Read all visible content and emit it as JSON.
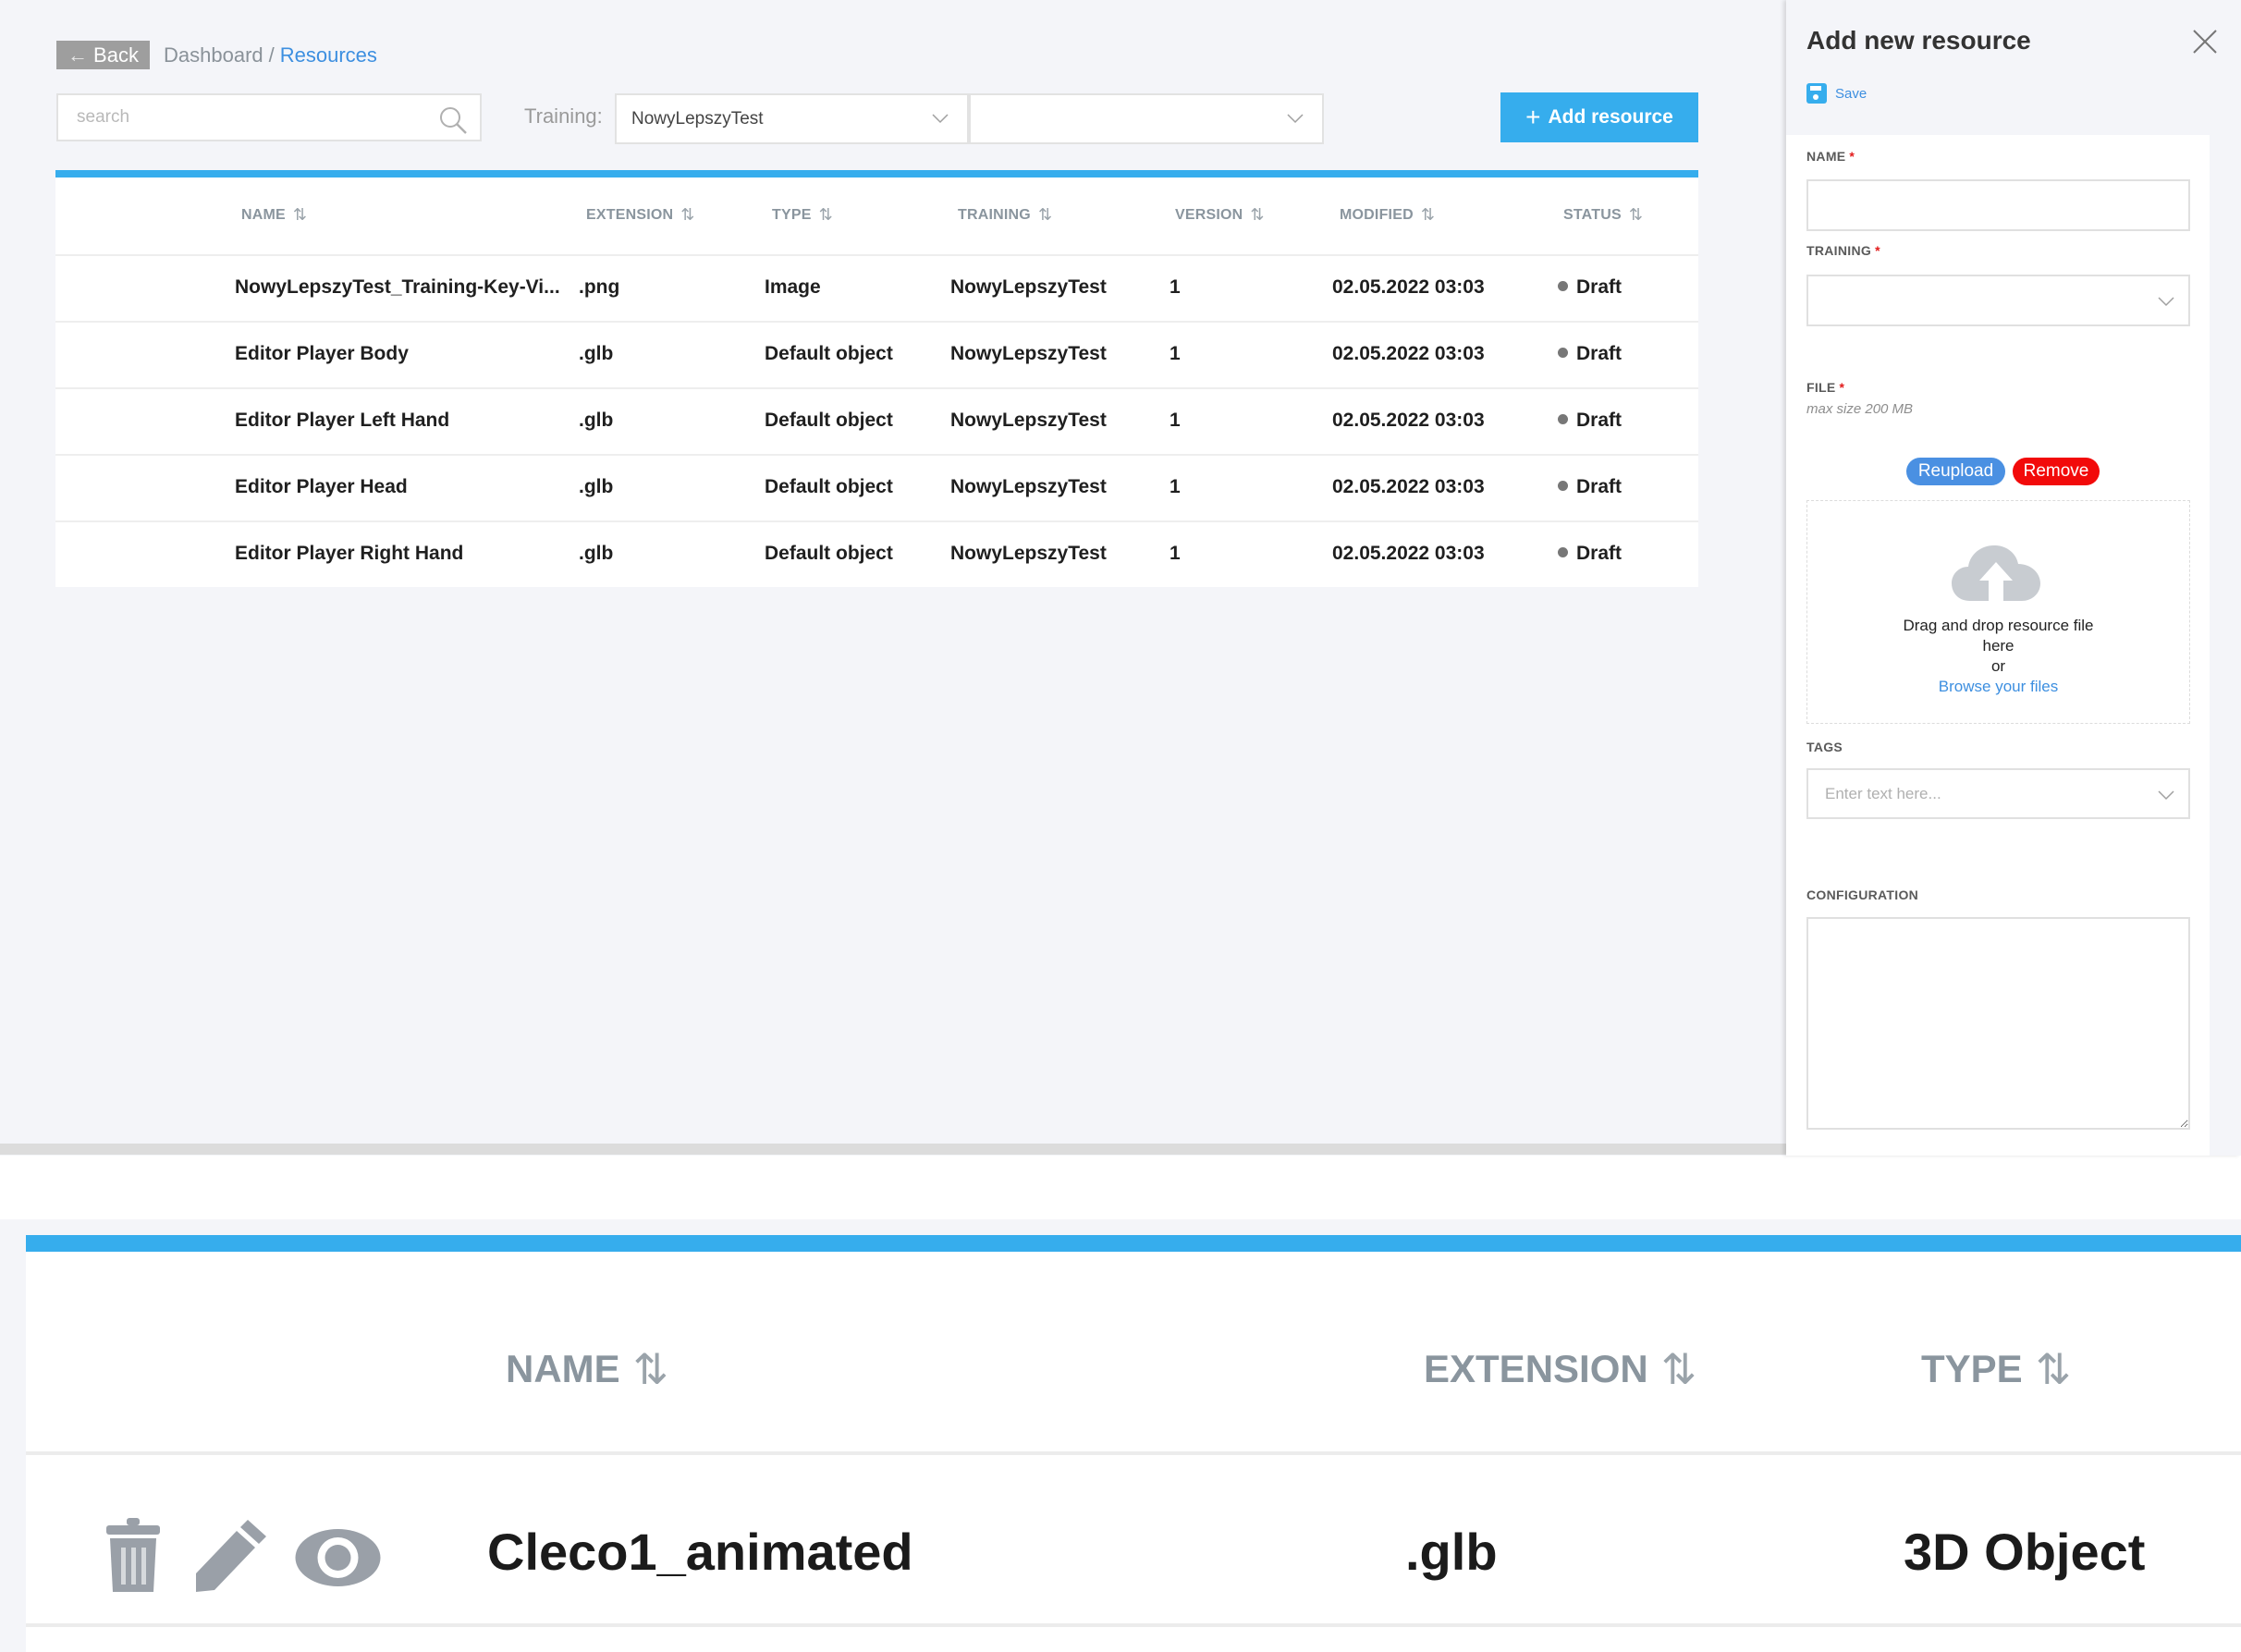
{
  "header": {
    "back_label": "Back",
    "back_icon": "arrow-left-icon",
    "breadcrumb": [
      {
        "label": "Dashboard"
      },
      {
        "label": "/"
      },
      {
        "label": "Resources"
      }
    ]
  },
  "toolbar": {
    "search_placeholder": "search",
    "search_value": "",
    "search_icon": "search-icon",
    "training_label": "Training:",
    "training_select_value": "NowyLepszyTest",
    "second_select_value": "",
    "add_resource_label": "Add resource",
    "add_resource_icon": "plus-icon"
  },
  "table": {
    "accent_color": "#36aded",
    "sort_glyph": "⇅",
    "columns": [
      "NAME",
      "EXTENSION",
      "TYPE",
      "TRAINING",
      "VERSION",
      "MODIFIED",
      "STATUS"
    ],
    "rows": [
      {
        "name": "NowyLepszyTest_Training-Key-Vi...",
        "extension": ".png",
        "type": "Image",
        "training": "NowyLepszyTest",
        "version": "1",
        "modified": "02.05.2022 03:03",
        "status": "Draft"
      },
      {
        "name": "Editor Player Body",
        "extension": ".glb",
        "type": "Default object",
        "training": "NowyLepszyTest",
        "version": "1",
        "modified": "02.05.2022 03:03",
        "status": "Draft"
      },
      {
        "name": "Editor Player Left Hand",
        "extension": ".glb",
        "type": "Default object",
        "training": "NowyLepszyTest",
        "version": "1",
        "modified": "02.05.2022 03:03",
        "status": "Draft"
      },
      {
        "name": "Editor Player Head",
        "extension": ".glb",
        "type": "Default object",
        "training": "NowyLepszyTest",
        "version": "1",
        "modified": "02.05.2022 03:03",
        "status": "Draft"
      },
      {
        "name": "Editor Player Right Hand",
        "extension": ".glb",
        "type": "Default object",
        "training": "NowyLepszyTest",
        "version": "1",
        "modified": "02.05.2022 03:03",
        "status": "Draft"
      }
    ]
  },
  "panel": {
    "title": "Add new resource",
    "close_icon": "close-icon",
    "save_label": "Save",
    "save_icon": "floppy-disk-icon",
    "required_mark": "*",
    "name_label": "NAME",
    "name_value": "",
    "training_label": "TRAINING",
    "training_value": "",
    "file_label": "FILE",
    "file_hint": "max size 200 MB",
    "reupload_label": "Reupload",
    "remove_label": "Remove",
    "reupload_color": "#4a90e2",
    "remove_color": "#f20a0a",
    "dropzone_icon": "cloud-upload-icon",
    "dropzone_line1": "Drag and drop resource file",
    "dropzone_line2": "here",
    "dropzone_line3": "or",
    "dropzone_browse": "Browse your files",
    "tags_label": "TAGS",
    "tags_placeholder": "Enter text here...",
    "configuration_label": "CONFIGURATION",
    "configuration_value": ""
  },
  "zoomed_detail": {
    "columns": [
      "NAME",
      "EXTENSION",
      "TYPE"
    ],
    "row": {
      "actions": [
        "trash-icon",
        "pencil-icon",
        "eye-icon"
      ],
      "name": "Cleco1_animated",
      "extension": ".glb",
      "type": "3D Object"
    }
  }
}
